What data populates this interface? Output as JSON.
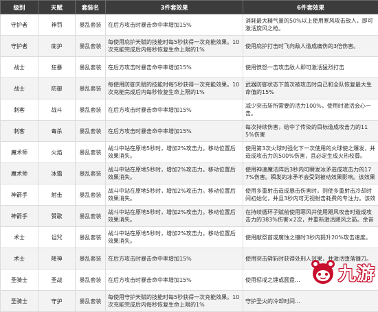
{
  "headers": {
    "class": "级别",
    "talent": "天赋",
    "set_name": "套装名",
    "set3": "3件套效果",
    "set6": "6件套效果"
  },
  "rows": [
    {
      "class": "守护者",
      "talent": "神罚",
      "set_name": "暴乱套装",
      "set3": "在后方攻击时暴击命中率增加15%",
      "set6": "消耗最大精气量的50%以上使用寒风攻击敌人，即可激活旋风之枪。"
    },
    {
      "class": "守护者",
      "talent": "庇护",
      "set_name": "暴乱套装",
      "set3": "每使用庇护天赋的技能时每5秒获得一次充能效果。10次充能完成后内每秒恢复生命上限的1%",
      "set6": "使用庇护打击时飞向敌人造成痛伤的3倍伤害。"
    },
    {
      "class": "战士",
      "talent": "狂暴",
      "set_name": "暴乱套装",
      "set3": "在后方攻击时暴击命中率增加15%",
      "set6": "使用愤怒一击攻击敌人即可激活猛烈打击"
    },
    {
      "class": "战士",
      "talent": "防御",
      "set_name": "暴乱套装",
      "set3": "每使用防御天赋的技能时每5秒获得一次充能效果。10次充能完成后内每秒恢复生命上限的1%",
      "set6": "武器防御状态下首次被攻击时自己和全队恢复最大生命值的15%"
    },
    {
      "class": "刺客",
      "talent": "战斗",
      "set_name": "暴乱套装",
      "set3": "在后方攻击时暴击命中率增加15%",
      "set6": "减少突击斩所需要的活力100%，使用时激活会心一击。"
    },
    {
      "class": "刺客",
      "talent": "毒杀",
      "set_name": "暴乱套装",
      "set3": "在后方攻击时暴击命中率增加15%",
      "set6": "每次持续伤害，给中了传染的目标造成攻击力的115%伤害"
    },
    {
      "class": "魔术师",
      "talent": "火焰",
      "set_name": "暴乱套装",
      "set3": "战斗中站在原地5秒时，增加2%攻击力。移动位置后效果消失。",
      "set6": "使用第3次火球时强化下一次使用的火球使之爆发，并造成攻击力的500%伤害，且必定生成火热校募。"
    },
    {
      "class": "魔术师",
      "talent": "冰霜",
      "set_name": "暴乱套装",
      "set3": "战斗中站在原地5秒时，增加2%攻击力。移动位置后效果消失。",
      "set6": "使用神速魔法阵后3秒内可瞬发冰矛造成攻击力的177%伤害。瞬发的冰矛不会受到被动效果影响。该效果是神速魔法阵消失后。"
    },
    {
      "class": "神箭手",
      "talent": "射击",
      "set_name": "暴乱套装",
      "set3": "战斗中站在原地5秒时，增加2%攻击力。移动位置后效果消失。",
      "set6": "使用多重射击造成暴击伤害时，则使多重射击冷却时间初始化，并且3秒内可无视射击耗费的专注力。该效果只能每30秒激活一次。"
    },
    {
      "class": "神箭手",
      "talent": "赞歌",
      "set_name": "暴乱套装",
      "set3": "战斗中站在原地5秒时，增加2%攻击力。移动位置后效果消失。",
      "set6": "在持续循环子赋前使用寒风并使用飓风攻击时造成攻击力的383%伤害×2次，并重新激活飓风之箭。余音绕梁效果下不适用。"
    },
    {
      "class": "术士",
      "talent": "诅咒",
      "set_name": "暴乱套装",
      "set3": "战斗中站在原地5秒时，增加2%攻击力。移动位置后效果消失。",
      "set6": "使用献祭首或腐蚀之镰时3秒内提升20%攻击速度。"
    },
    {
      "class": "术士",
      "talent": "降神",
      "set_name": "暴乱套装",
      "set3": "在后方攻击时暴击命中率增加15%",
      "set6": "使用突击劈斩时获得处刑人效果，并激活堕落镰刀。"
    },
    {
      "class": "圣骑士",
      "talent": "圣战",
      "set_name": "暴乱套装",
      "set3": "在后方攻击时暴击命中率增加15%",
      "set6": "使用惩戒之锤或圆盘…"
    },
    {
      "class": "圣骑士",
      "talent": "守护",
      "set_name": "暴乱套装",
      "set3": "每使用守护天赋的技能时每5秒获得一次充能效果。10次充能完成后内每秒恢复生命上限的1%",
      "set6": "守护圣火的冷却时间…"
    }
  ],
  "watermark": {
    "text": "九游",
    "brand_color": "#c8102e"
  }
}
